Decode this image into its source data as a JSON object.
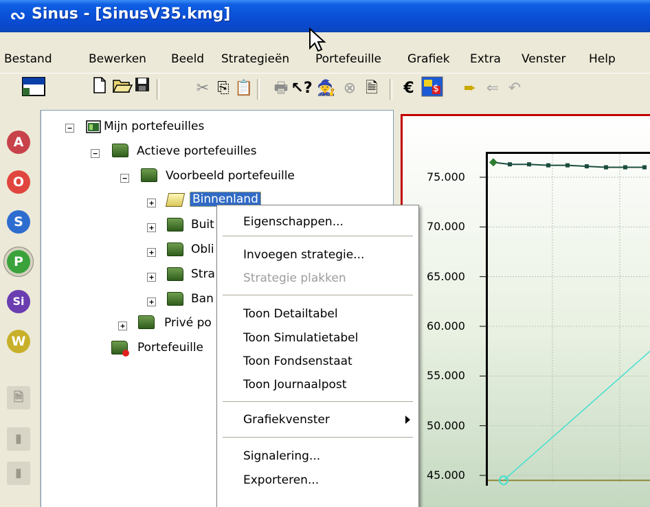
{
  "app": {
    "title": "Sinus - [SinusV35.kmg]"
  },
  "menu": [
    "Bestand",
    "Bewerken",
    "Beeld",
    "Strategieën",
    "Portefeuille",
    "Grafiek",
    "Extra",
    "Venster",
    "Help"
  ],
  "toolbar": {
    "icons": [
      "layout-icon",
      "new-icon",
      "open-icon",
      "save-icon",
      "cut-icon",
      "copy-icon",
      "paste-icon",
      "print-icon",
      "help-pointer-icon",
      "wizard-icon",
      "stop-icon",
      "properties-icon",
      "euro-icon",
      "currency-icon",
      "forward-icon",
      "back-icon",
      "undo-icon"
    ],
    "euro_glyph": "€"
  },
  "left_toolbar": {
    "buttons": [
      "A",
      "O",
      "S",
      "P",
      "Si",
      "W"
    ]
  },
  "tree": {
    "root": "Mijn portefeuilles",
    "active": "Actieve portefeuilles",
    "example": "Voorbeeld portefeuille",
    "children": [
      "Binnenland",
      "Buit",
      "Obli",
      "Stra",
      "Ban"
    ],
    "private": "Privé po",
    "other": "Portefeuille"
  },
  "context_menu": {
    "items": [
      "Eigenschappen...",
      "Invoegen strategie...",
      "Strategie plakken",
      "Toon Detailtabel",
      "Toon Simulatietabel",
      "Toon Fondsenstaat",
      "Toon Journaalpost",
      "Grafiekvenster",
      "Signalering...",
      "Exporteren..."
    ],
    "disabled": [
      "Strategie plakken"
    ]
  },
  "chart_data": {
    "type": "line",
    "yticks": [
      "75.000",
      "70.000",
      "65.000",
      "60.000",
      "55.000",
      "50.000",
      "45.000"
    ],
    "ylim": [
      45000,
      77500
    ],
    "series": [
      {
        "color": "#1b4d3e",
        "values": [
          76500,
          76300,
          76300,
          76200,
          76200,
          76100,
          76000
        ]
      },
      {
        "color": "#40e0d0",
        "values": [
          44500,
          57500
        ]
      }
    ]
  }
}
